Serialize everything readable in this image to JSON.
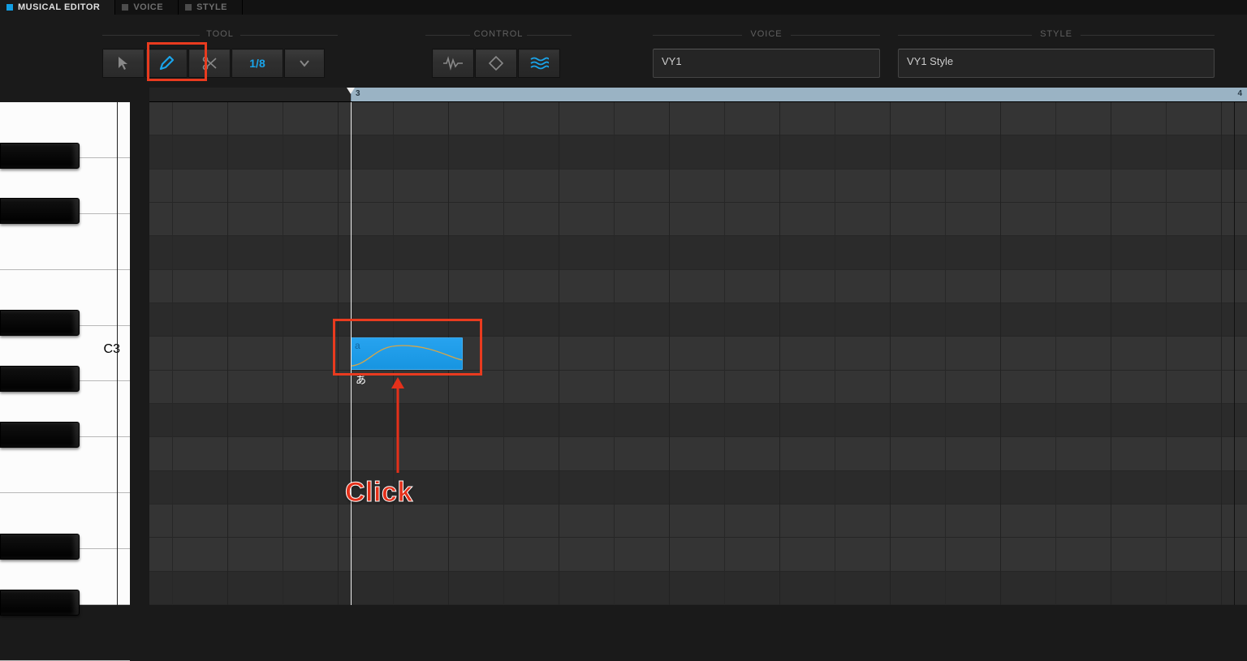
{
  "tabs": {
    "musical_editor": "MUSICAL EDITOR",
    "voice": "VOICE",
    "style": "STYLE"
  },
  "toolbar": {
    "labels": {
      "tool": "TOOL",
      "control": "CONTROL",
      "voice": "VOICE",
      "style": "STYLE"
    },
    "quantize": "1/8"
  },
  "ruler": {
    "markers": [
      "3",
      "4"
    ]
  },
  "voice": {
    "value": "VY1"
  },
  "style": {
    "value": "VY1 Style"
  },
  "piano": {
    "octave_label": "C3"
  },
  "note": {
    "phoneme": "a",
    "lyric": "あ"
  },
  "annotation": {
    "click": "Click"
  },
  "colors": {
    "accent": "#19a4ea",
    "anno": "#e93b1f"
  }
}
